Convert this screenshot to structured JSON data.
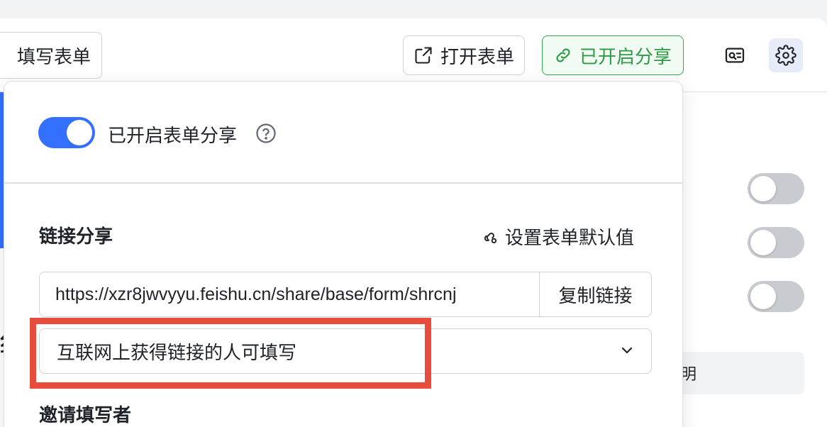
{
  "header": {
    "fill_form_label": "填写表单",
    "open_form_label": "打开表单",
    "share_label": "已开启分享",
    "ticket_icon": "ticket-search-icon",
    "settings_icon": "gear-icon"
  },
  "share_popover": {
    "toggle_label": "已开启表单分享",
    "toggle_on": true,
    "help_icon": "question-circle-icon",
    "link_section_title": "链接分享",
    "default_values_label": "设置表单默认值",
    "link_value": "https://xzr8jwvyyu.feishu.cn/share/base/form/shrcnj",
    "copy_label": "复制链接",
    "permission_selected": "互联网上获得链接的人可填写",
    "invite_section_title": "邀请填写者"
  },
  "background": {
    "right_box_text": "明",
    "left_glyph": "纟"
  },
  "colors": {
    "accent_blue": "#3370ff",
    "share_green": "#34a853",
    "highlight_red": "#e74c3c"
  }
}
